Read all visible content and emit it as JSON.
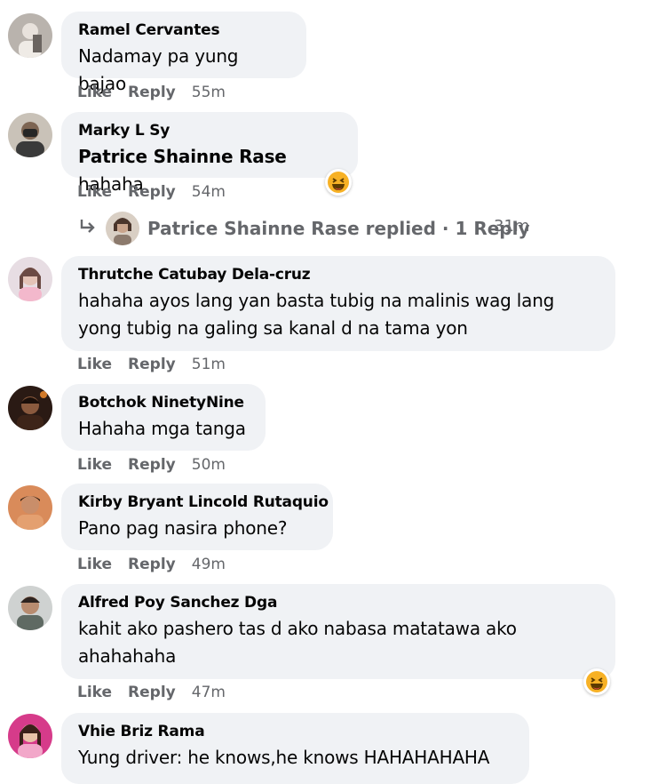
{
  "comments": [
    {
      "author": "Ramel Cervantes",
      "text": "Nadamay pa yung bajao",
      "like": "Like",
      "reply": "Reply",
      "time": "55m"
    },
    {
      "author": "Marky L Sy",
      "mention": "Patrice Shainne Rase",
      "text": "hahaha",
      "like": "Like",
      "reply": "Reply",
      "time": "54m",
      "reaction": "haha-icon"
    },
    {
      "author": "Thrutche Catubay Dela-cruz",
      "text": "hahaha ayos lang yan basta tubig na malinis wag lang yong tubig na galing sa kanal d na tama yon",
      "like": "Like",
      "reply": "Reply",
      "time": "51m"
    },
    {
      "author": "Botchok NinetyNine",
      "text": "Hahaha mga tanga",
      "like": "Like",
      "reply": "Reply",
      "time": "50m"
    },
    {
      "author": "Kirby Bryant Lincold Rutaquio",
      "text": "Pano pag nasira phone?",
      "like": "Like",
      "reply": "Reply",
      "time": "49m"
    },
    {
      "author": "Alfred Poy Sanchez Dga",
      "text": "kahit ako pashero tas d ako nabasa matatawa ako ahahahaha",
      "like": "Like",
      "reply": "Reply",
      "time": "47m",
      "reaction": "haha-icon"
    },
    {
      "author": "Vhie Briz Rama",
      "text": "Yung driver: he knows,he knows HAHAHAHAHA"
    }
  ],
  "replies_link": {
    "text": "Patrice Shainne Rase replied · 1 Reply",
    "time": "31m",
    "icon": "reply-arrow-icon"
  },
  "colors": {
    "bubble": "#f0f2f5",
    "muted": "#65676b",
    "text": "#050505",
    "haha": "#f7b125"
  }
}
